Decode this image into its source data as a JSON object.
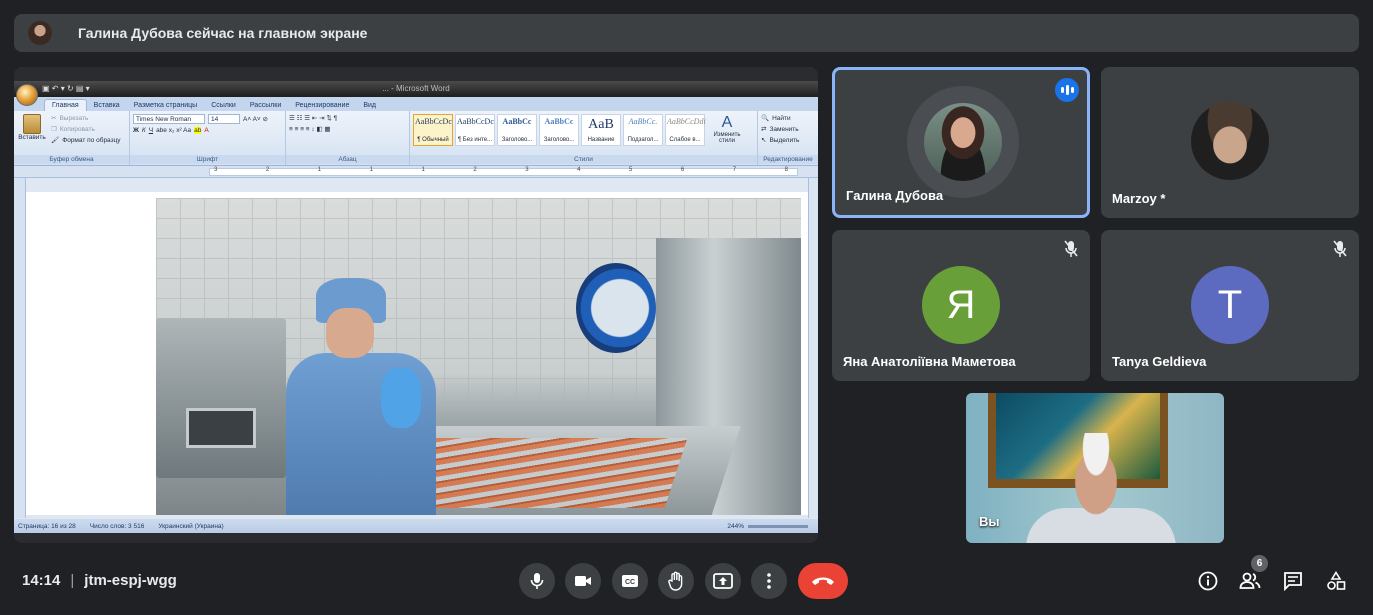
{
  "banner": {
    "text": "Галина Дубова сейчас на главном экране"
  },
  "word": {
    "title": "... - Microsoft Word",
    "tabs": [
      "Главная",
      "Вставка",
      "Разметка страницы",
      "Ссылки",
      "Рассылки",
      "Рецензирование",
      "Вид"
    ],
    "clipboard": {
      "paste": "Вставить",
      "cut": "Вырезать",
      "copy": "Копировать",
      "format_painter": "Формат по образцу",
      "group": "Буфер обмена"
    },
    "font": {
      "name": "Times New Roman",
      "size": "14",
      "group": "Шрифт"
    },
    "paragraph": {
      "group": "Абзац"
    },
    "styles": {
      "group": "Стили",
      "items": [
        {
          "sample": "AaBbCcDc",
          "label": "¶ Обычный"
        },
        {
          "sample": "AaBbCcDc",
          "label": "¶ Без инте..."
        },
        {
          "sample": "AaBbCc",
          "label": "Заголово..."
        },
        {
          "sample": "AaBbCc",
          "label": "Заголово..."
        },
        {
          "sample": "AaB",
          "label": "Название"
        },
        {
          "sample": "AaBbCc.",
          "label": "Подзагол..."
        },
        {
          "sample": "AaBbCcDdi",
          "label": "Слабое в..."
        }
      ],
      "change": "Изменить стили"
    },
    "editing": {
      "find": "Найти",
      "replace": "Заменить",
      "select": "Выделить",
      "group": "Редактирование"
    },
    "status": {
      "page": "Страница: 16 из 28",
      "words": "Число слов: 3 516",
      "lang": "Украинский (Украина)",
      "zoom": "244%"
    },
    "ruler_numbers": [
      "3",
      "2",
      "1",
      "1",
      "1",
      "2",
      "3",
      "4",
      "5",
      "6",
      "7",
      "8"
    ]
  },
  "participants": [
    {
      "name": "Галина Дубова",
      "speaking": true
    },
    {
      "name": "Marzoy *"
    },
    {
      "name": "Яна Анатоліївна Маметова",
      "initial": "Я",
      "color": "#689f38",
      "muted": true
    },
    {
      "name": "Tanya Geldieva",
      "initial": "T",
      "color": "#5c6bc0",
      "muted": true
    }
  ],
  "self": {
    "name": "Вы"
  },
  "meeting": {
    "time": "14:14",
    "code": "jtm-espj-wgg"
  },
  "people_count": "6",
  "colors": {
    "accent": "#8ab4f8",
    "hangup": "#ea4335",
    "bg": "#202124",
    "tile": "#3c4043"
  }
}
